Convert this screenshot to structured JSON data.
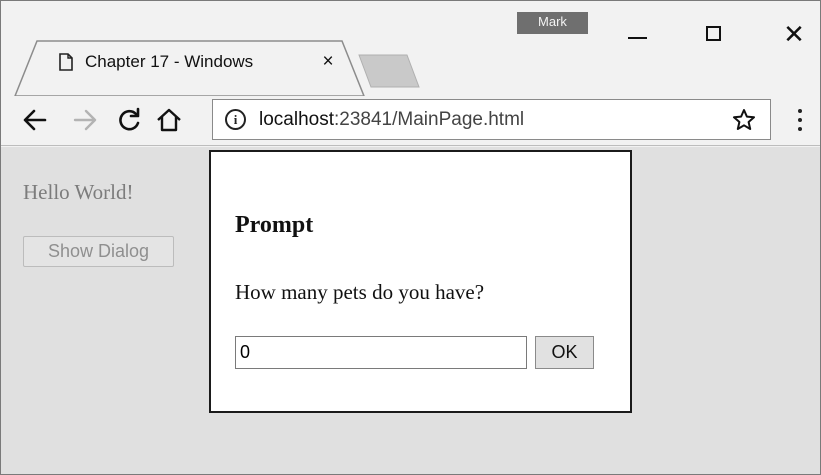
{
  "browser": {
    "tab": {
      "title": "Chapter 17 - Windows",
      "close_glyph": "×",
      "icon": "page-icon"
    },
    "profile_name": "Mark",
    "window_controls": {
      "minimize_icon": "minimize-icon",
      "maximize_icon": "maximize-icon",
      "close_glyph": "✕"
    },
    "toolbar": {
      "back_icon": "back-arrow-icon",
      "forward_icon": "forward-arrow-icon",
      "reload_icon": "reload-icon",
      "home_icon": "home-icon",
      "info_glyph": "i",
      "url_host": "localhost",
      "url_rest": ":23841/MainPage.html",
      "bookmark_icon": "star-icon",
      "menu_icon": "more-vertical-icon"
    }
  },
  "page": {
    "heading": "Hello World!",
    "show_dialog_label": "Show Dialog"
  },
  "dialog": {
    "title": "Prompt",
    "message": "How many pets do you have?",
    "input_value": "0",
    "ok_label": "OK"
  }
}
